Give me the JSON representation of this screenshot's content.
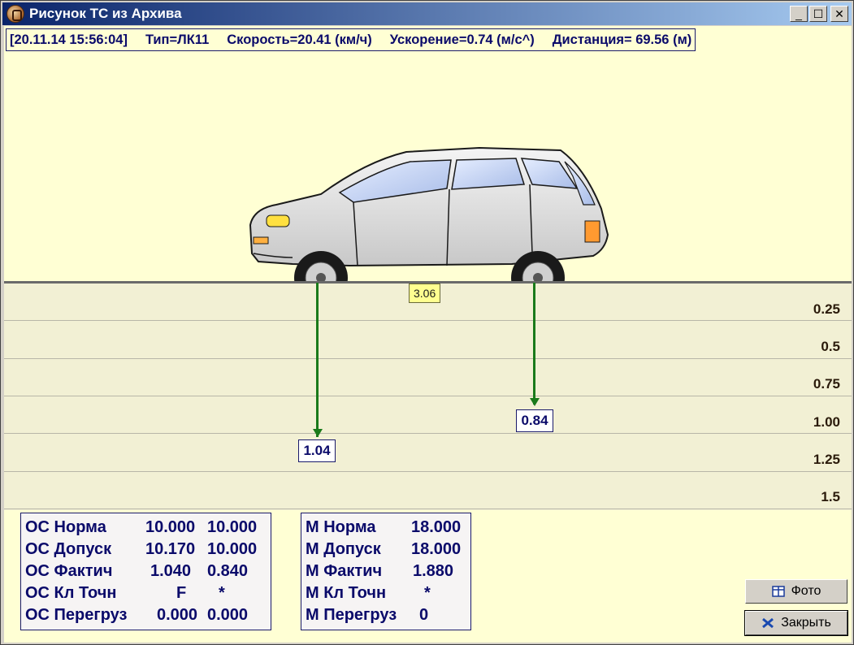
{
  "window": {
    "title": "Рисунок ТС из Архива"
  },
  "window_buttons": {
    "minimize": "_",
    "maximize": "☐",
    "close": "✕"
  },
  "info": {
    "datetime": "[20.11.14 15:56:04]",
    "type": "Тип=ЛК11",
    "speed": "Скорость=20.41 (км/ч)",
    "acceleration": "Ускорение=0.74 (м/с^)",
    "distance": "Дистанция= 69.56 (м)"
  },
  "scale": {
    "labels": [
      "0.25",
      "0.5",
      "0.75",
      "1.00",
      "1.25",
      "1.5"
    ]
  },
  "axle_distance": "3.06",
  "axles": [
    {
      "value_label": "1.04",
      "value": 1.04
    },
    {
      "value_label": "0.84",
      "value": 0.84
    }
  ],
  "os_table": [
    {
      "label": "ОС Норма",
      "v1": "10.000",
      "v2": "10.000"
    },
    {
      "label": "ОС Допуск",
      "v1": "10.170",
      "v2": "10.000"
    },
    {
      "label": "ОС Фактич",
      "v1": "1.040",
      "v2": "0.840"
    },
    {
      "label": "ОС Кл Точн",
      "v1": "F",
      "v2": "*"
    },
    {
      "label": "ОС Перегруз",
      "v1": "0.000",
      "v2": "0.000"
    }
  ],
  "m_table": [
    {
      "label": "М Норма",
      "v1": "18.000"
    },
    {
      "label": "М Допуск",
      "v1": "18.000"
    },
    {
      "label": "М Фактич",
      "v1": "1.880"
    },
    {
      "label": "М Кл Точн",
      "v1": "*"
    },
    {
      "label": "М Перегруз",
      "v1": "0"
    }
  ],
  "buttons": {
    "photo": "Фото",
    "close": "Закрыть"
  },
  "icons": {
    "photo": "grid-photo-icon",
    "close": "x-close-icon",
    "app": "app-logo-icon"
  },
  "colors": {
    "background": "#ffffd4",
    "title_start": "#0a246a",
    "text": "#0a0a6a",
    "arrow": "#1a7a1a"
  }
}
